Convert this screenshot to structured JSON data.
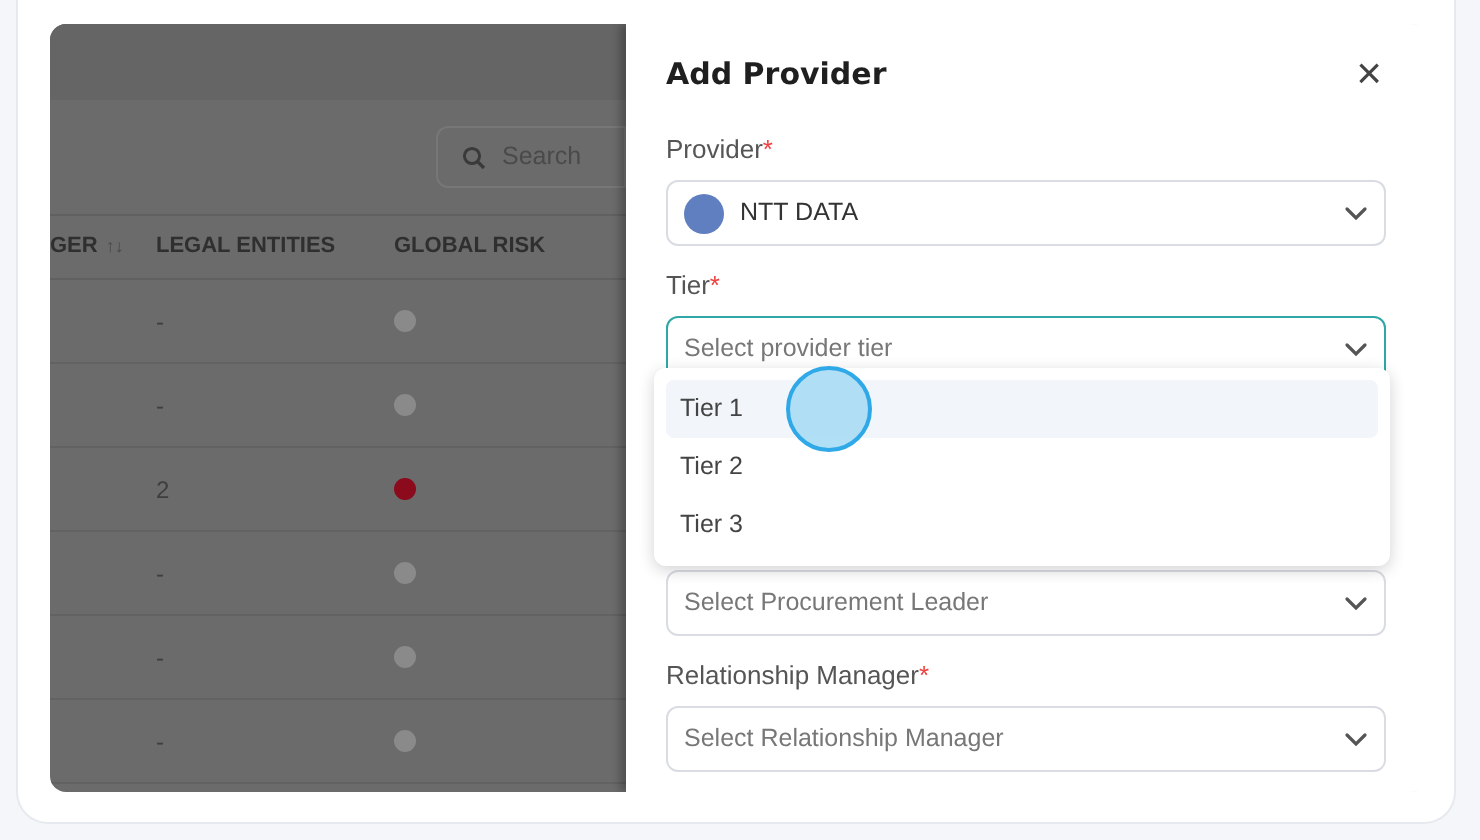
{
  "table": {
    "search": {
      "placeholder": "Search"
    },
    "columns": [
      {
        "label": "GER",
        "sort_icon": "↑↓"
      },
      {
        "label": "LEGAL ENTITIES"
      },
      {
        "label": "GLOBAL RISK"
      }
    ],
    "rows": [
      {
        "legal_entities": "-",
        "color": "#8a8a8a"
      },
      {
        "legal_entities": "-",
        "color": "#8a8a8a"
      },
      {
        "legal_entities": "2",
        "color": "#8b0a1c"
      },
      {
        "legal_entities": "-",
        "color": "#8a8a8a"
      },
      {
        "legal_entities": "-",
        "color": "#8a8a8a"
      },
      {
        "legal_entities": "-",
        "color": "#8a8a8a"
      }
    ]
  },
  "drawer": {
    "title": "Add Provider",
    "close": "×",
    "fields": [
      {
        "kind": "select",
        "label": "Provider",
        "required_mark": "*",
        "value": "NTT DATA",
        "logo": true,
        "focused": false
      },
      {
        "kind": "select",
        "label": "Tier",
        "required_mark": "*",
        "placeholder": "Select provider tier",
        "focused": true,
        "open": true
      },
      {
        "kind": "select",
        "placeholder": "Select Procurement Leader",
        "focused": false
      },
      {
        "kind": "select",
        "label": "Relationship Manager",
        "required_mark": "*",
        "placeholder": "Select Relationship Manager",
        "focused": false
      }
    ],
    "tier_options": [
      {
        "label": "Tier 1",
        "selected": true
      },
      {
        "label": "Tier 2",
        "selected": false
      },
      {
        "label": "Tier 3",
        "selected": false
      }
    ]
  }
}
